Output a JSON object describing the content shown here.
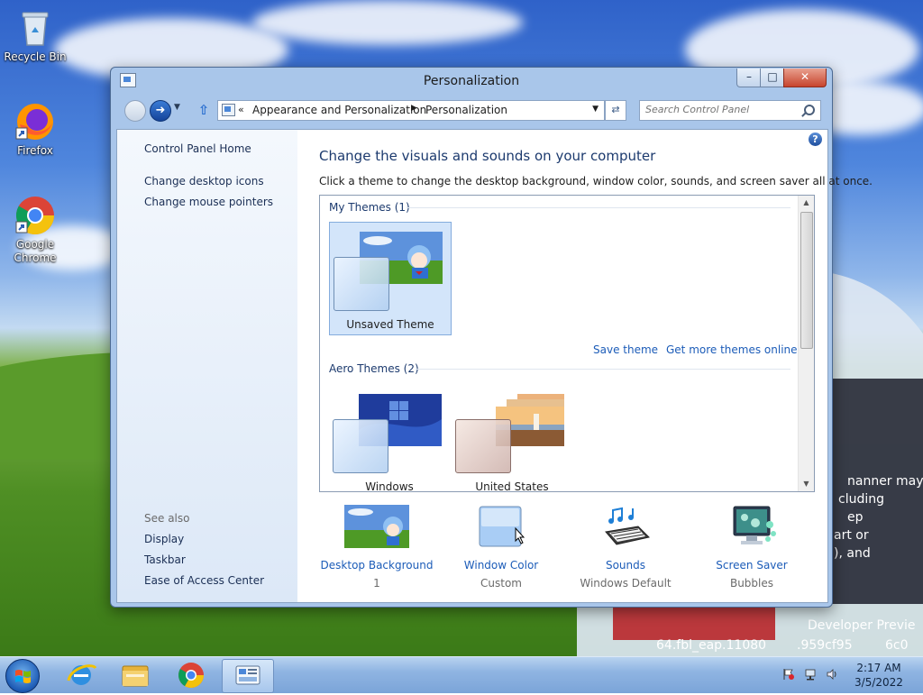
{
  "desktop": {
    "icons": [
      {
        "label": "Recycle Bin"
      },
      {
        "label": "Firefox"
      },
      {
        "label": "Google\nChrome"
      }
    ],
    "overlay_lines": [
      "nanner may",
      "cluding",
      "ep",
      "art or",
      "), and",
      "Developer Previe",
      "64.fbl_eap.11080",
      ".959cf95",
      "6c0"
    ]
  },
  "window": {
    "title": "Personalization",
    "controls": {
      "minimize": "–",
      "maximize": "□",
      "close": "✕"
    },
    "breadcrumb": [
      "Appearance and Personalization",
      "Personalization"
    ],
    "breadcrumb_prefix": "«",
    "search": {
      "placeholder": "Search Control Panel"
    },
    "left_pane": {
      "home": "Control Panel Home",
      "links": [
        "Change desktop icons",
        "Change mouse pointers"
      ],
      "see_also_title": "See also",
      "see_also": [
        "Display",
        "Taskbar",
        "Ease of Access Center"
      ]
    },
    "main": {
      "heading": "Change the visuals and sounds on your computer",
      "description": "Click a theme to change the desktop background, window color, sounds, and screen saver all at once.",
      "my_themes_header": "My Themes (1)",
      "my_themes": [
        {
          "name": "Unsaved Theme"
        }
      ],
      "save_theme": "Save theme",
      "get_more": "Get more themes online",
      "aero_themes_header": "Aero Themes (2)",
      "aero_themes": [
        {
          "name": "Windows"
        },
        {
          "name": "United States"
        }
      ]
    },
    "bottom": [
      {
        "label": "Desktop Background",
        "value": "1"
      },
      {
        "label": "Window Color",
        "value": "Custom"
      },
      {
        "label": "Sounds",
        "value": "Windows Default"
      },
      {
        "label": "Screen Saver",
        "value": "Bubbles"
      }
    ]
  },
  "taskbar": {
    "time": "2:17 AM",
    "date": "3/5/2022"
  }
}
